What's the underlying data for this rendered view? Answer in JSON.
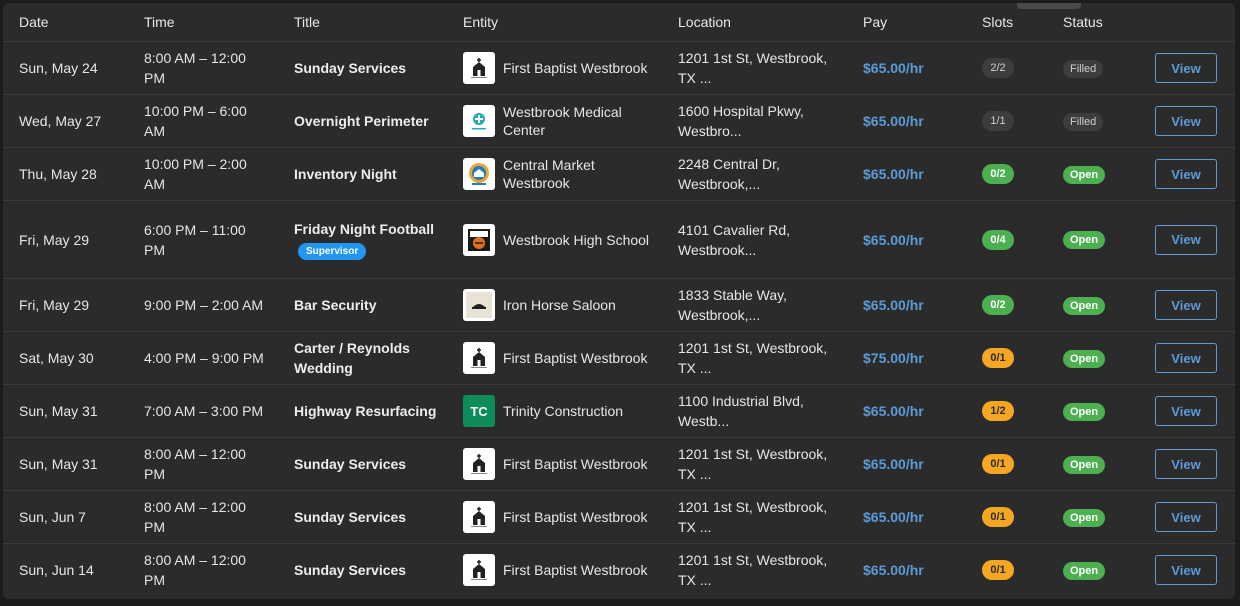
{
  "columns": {
    "date": "Date",
    "time": "Time",
    "title": "Title",
    "entity": "Entity",
    "location": "Location",
    "pay": "Pay",
    "slots": "Slots",
    "status": "Status"
  },
  "colors": {
    "pay": "#5b9bd8",
    "open": "#4caf50",
    "partial": "#f5a623",
    "filled": "#3d3d3d",
    "supervisor": "#2196f3"
  },
  "rows": [
    {
      "date": "Sun, May 24",
      "time": "8:00 AM – 12:00 PM",
      "title": "Sunday Services",
      "badge": "",
      "entity": "First Baptist Westbrook",
      "entity_icon": "church-icon",
      "location": "1201 1st St, Westbrook, TX ...",
      "pay": "$65.00/hr",
      "slots": "2/2",
      "slot_state": "filled",
      "status": "Filled",
      "action": "View"
    },
    {
      "date": "Wed, May 27",
      "time": "10:00 PM – 6:00 AM",
      "title": "Overnight Perimeter",
      "badge": "",
      "entity": "Westbrook Medical Center",
      "entity_icon": "medical-icon",
      "location": "1600 Hospital Pkwy, Westbro...",
      "pay": "$65.00/hr",
      "slots": "1/1",
      "slot_state": "filled",
      "status": "Filled",
      "action": "View"
    },
    {
      "date": "Thu, May 28",
      "time": "10:00 PM – 2:00 AM",
      "title": "Inventory Night",
      "badge": "",
      "entity": "Central Market Westbrook",
      "entity_icon": "market-icon",
      "location": "2248 Central Dr, Westbrook,...",
      "pay": "$65.00/hr",
      "slots": "0/2",
      "slot_state": "open",
      "status": "Open",
      "action": "View"
    },
    {
      "date": "Fri, May 29",
      "time": "6:00 PM – 11:00 PM",
      "title": "Friday Night Football",
      "badge": "Supervisor",
      "entity": "Westbrook High School",
      "entity_icon": "cavalier-icon",
      "location": "4101 Cavalier Rd, Westbrook...",
      "pay": "$65.00/hr",
      "slots": "0/4",
      "slot_state": "open",
      "status": "Open",
      "action": "View"
    },
    {
      "date": "Fri, May 29",
      "time": "9:00 PM – 2:00 AM",
      "title": "Bar Security",
      "badge": "",
      "entity": "Iron Horse Saloon",
      "entity_icon": "saloon-icon",
      "location": "1833 Stable Way, Westbrook,...",
      "pay": "$65.00/hr",
      "slots": "0/2",
      "slot_state": "open",
      "status": "Open",
      "action": "View"
    },
    {
      "date": "Sat, May 30",
      "time": "4:00 PM – 9:00 PM",
      "title": "Carter / Reynolds Wedding",
      "badge": "",
      "entity": "First Baptist Westbrook",
      "entity_icon": "church-icon",
      "location": "1201 1st St, Westbrook, TX ...",
      "pay": "$75.00/hr",
      "slots": "0/1",
      "slot_state": "partial",
      "status": "Open",
      "action": "View"
    },
    {
      "date": "Sun, May 31",
      "time": "7:00 AM – 3:00 PM",
      "title": "Highway Resurfacing",
      "badge": "",
      "entity": "Trinity Construction",
      "entity_icon": "tc-icon",
      "entity_initials": "TC",
      "location": "1100 Industrial Blvd, Westb...",
      "pay": "$65.00/hr",
      "slots": "1/2",
      "slot_state": "partial",
      "status": "Open",
      "action": "View"
    },
    {
      "date": "Sun, May 31",
      "time": "8:00 AM – 12:00 PM",
      "title": "Sunday Services",
      "badge": "",
      "entity": "First Baptist Westbrook",
      "entity_icon": "church-icon",
      "location": "1201 1st St, Westbrook, TX ...",
      "pay": "$65.00/hr",
      "slots": "0/1",
      "slot_state": "partial",
      "status": "Open",
      "action": "View"
    },
    {
      "date": "Sun, Jun 7",
      "time": "8:00 AM – 12:00 PM",
      "title": "Sunday Services",
      "badge": "",
      "entity": "First Baptist Westbrook",
      "entity_icon": "church-icon",
      "location": "1201 1st St, Westbrook, TX ...",
      "pay": "$65.00/hr",
      "slots": "0/1",
      "slot_state": "partial",
      "status": "Open",
      "action": "View"
    },
    {
      "date": "Sun, Jun 14",
      "time": "8:00 AM – 12:00 PM",
      "title": "Sunday Services",
      "badge": "",
      "entity": "First Baptist Westbrook",
      "entity_icon": "church-icon",
      "location": "1201 1st St, Westbrook, TX ...",
      "pay": "$65.00/hr",
      "slots": "0/1",
      "slot_state": "partial",
      "status": "Open",
      "action": "View"
    }
  ]
}
